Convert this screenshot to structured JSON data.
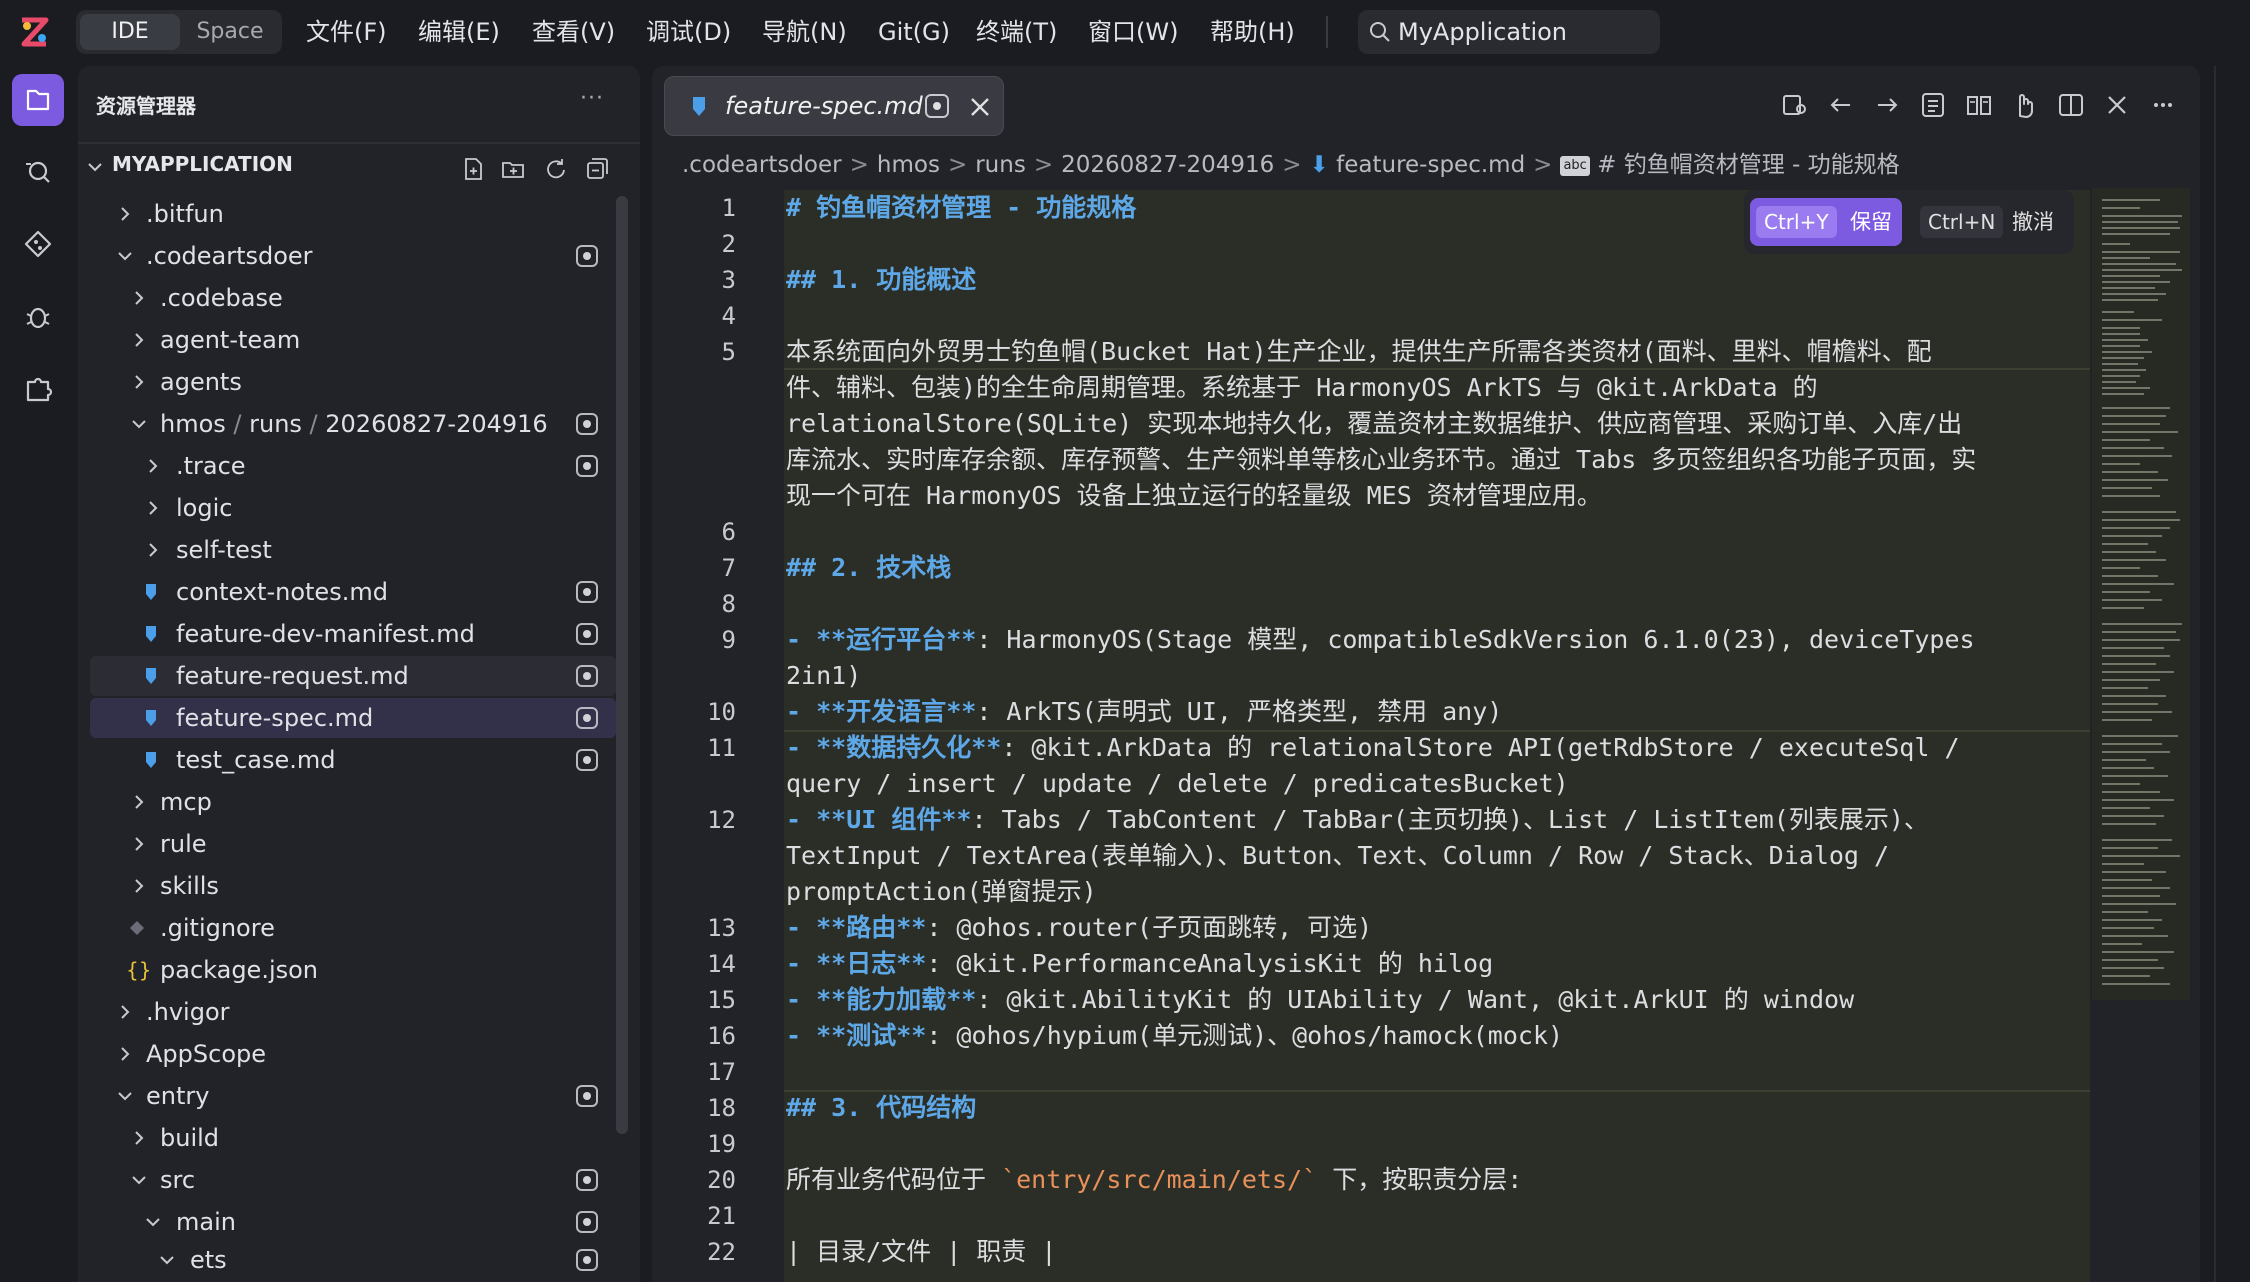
{
  "menubar": {
    "modes": [
      "IDE",
      "Space"
    ],
    "menus": [
      "文件(F)",
      "编辑(E)",
      "查看(V)",
      "调试(D)",
      "导航(N)",
      "Git(G)",
      "终端(T)",
      "窗口(W)",
      "帮助(H)"
    ],
    "search_text": "MyApplication"
  },
  "explorer": {
    "title": "资源管理器",
    "more": "···",
    "project": "MYAPPLICATION",
    "items": [
      {
        "label": ".bitfun"
      },
      {
        "label": ".codeartsdoer"
      },
      {
        "label": ".codebase"
      },
      {
        "label": "agent-team"
      },
      {
        "label": "agents"
      },
      {
        "label": "hmos",
        "path_tail": [
          "runs",
          "20260827-204916"
        ]
      },
      {
        "label": ".trace"
      },
      {
        "label": "logic"
      },
      {
        "label": "self-test"
      },
      {
        "label": "context-notes.md"
      },
      {
        "label": "feature-dev-manifest.md"
      },
      {
        "label": "feature-request.md"
      },
      {
        "label": "feature-spec.md"
      },
      {
        "label": "test_case.md"
      },
      {
        "label": "mcp"
      },
      {
        "label": "rule"
      },
      {
        "label": "skills"
      },
      {
        "label": ".gitignore"
      },
      {
        "label": "package.json"
      },
      {
        "label": ".hvigor"
      },
      {
        "label": "AppScope"
      },
      {
        "label": "entry"
      },
      {
        "label": "build"
      },
      {
        "label": "src"
      },
      {
        "label": "main"
      },
      {
        "label": "ets"
      }
    ]
  },
  "editor": {
    "tab_label": "feature-spec.md",
    "breadcrumb": [
      ".codeartsdoer",
      "hmos",
      "runs",
      "20260827-204916",
      "feature-spec.md",
      "# 钓鱼帽资材管理 - 功能规格"
    ],
    "diff_actions": {
      "keep_key": "Ctrl+Y",
      "keep_label": "保留",
      "undo_key": "Ctrl+N",
      "undo_label": "撤消"
    },
    "line_numbers": [
      "1",
      "2",
      "3",
      "4",
      "5",
      "6",
      "7",
      "8",
      "9",
      "10",
      "11",
      "12",
      "13",
      "14",
      "15",
      "16",
      "17",
      "18",
      "19",
      "20",
      "21",
      "22"
    ],
    "code": {
      "l1": "# 钓鱼帽资材管理 - 功能规格",
      "l3": "## 1. 功能概述",
      "l5a": "本系统面向外贸男士钓鱼帽(Bucket Hat)生产企业，提供生产所需各类资材(面料、里料、帽檐料、配",
      "l5b": "件、辅料、包装)的全生命周期管理。系统基于 HarmonyOS ArkTS 与 @kit.ArkData 的",
      "l5c": "relationalStore(SQLite) 实现本地持久化，覆盖资材主数据维护、供应商管理、采购订单、入库/出",
      "l5d": "库流水、实时库存余额、库存预警、生产领料单等核心业务环节。通过 Tabs 多页签组织各功能子页面，实",
      "l5e": "现一个可在 HarmonyOS 设备上独立运行的轻量级 MES 资材管理应用。",
      "l7": "## 2. 技术栈",
      "l9_key": "- **运行平台**",
      "l9_val": ": HarmonyOS(Stage 模型, compatibleSdkVersion 6.1.0(23), deviceTypes",
      "l9b": "2in1)",
      "l10_key": "- **开发语言**",
      "l10_val": ": ArkTS(声明式 UI, 严格类型, 禁用 any)",
      "l11_key": "- **数据持久化**",
      "l11_val": ": @kit.ArkData 的 relationalStore API(getRdbStore / executeSql /",
      "l11b": "query / insert / update / delete / predicatesBucket)",
      "l12_key": "- **UI 组件**",
      "l12_val": ": Tabs / TabContent / TabBar(主页切换)、List / ListItem(列表展示)、",
      "l12b": "TextInput / TextArea(表单输入)、Button、Text、Column / Row / Stack、Dialog /",
      "l12c": "promptAction(弹窗提示)",
      "l13_key": "- **路由**",
      "l13_val": ": @ohos.router(子页面跳转, 可选)",
      "l14_key": "- **日志**",
      "l14_val": ": @kit.PerformanceAnalysisKit 的 hilog",
      "l15_key": "- **能力加载**",
      "l15_val": ": @kit.AbilityKit 的 UIAbility / Want, @kit.ArkUI 的 window",
      "l16_key": "- **测试**",
      "l16_val": ": @ohos/hypium(单元测试)、@ohos/hamock(mock)",
      "l18": "## 3. 代码结构",
      "l20_pre": "所有业务代码位于 ",
      "l20_code": "`entry/src/main/ets/`",
      "l20_post": " 下，按职责分层:",
      "l22": "| 目录/文件 | 职责 |"
    }
  },
  "colors": {
    "accent": "#7d5be0",
    "heading": "#5ea8e8",
    "inline_code": "#e8915a",
    "diff_bg": "#2b2e26"
  }
}
